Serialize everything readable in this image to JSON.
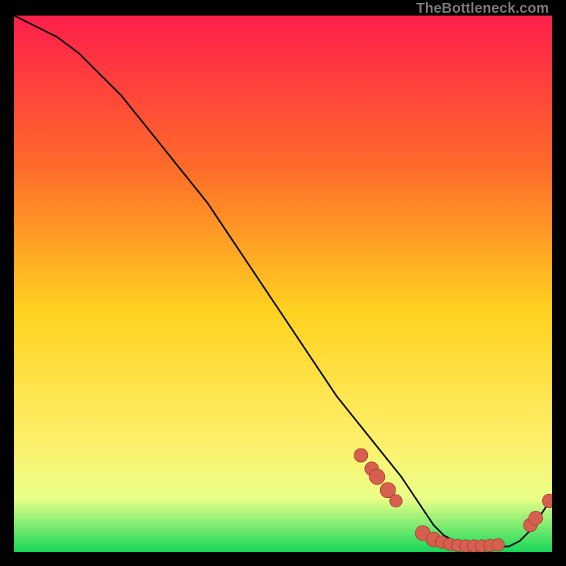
{
  "watermark": "TheBottleneck.com",
  "colors": {
    "gradient_top": "#ff1f4b",
    "gradient_mid_upper": "#ff6a2a",
    "gradient_mid": "#ffd21f",
    "gradient_mid_lower": "#ffee66",
    "gradient_lower": "#eaff88",
    "gradient_bottom": "#17d85a",
    "curve": "#111111",
    "marker_fill": "#d6604d",
    "marker_stroke": "#9c3a2e"
  },
  "chart_data": {
    "type": "line",
    "title": "",
    "xlabel": "",
    "ylabel": "",
    "xlim": [
      0,
      100
    ],
    "ylim": [
      0,
      100
    ],
    "grid": false,
    "legend": false,
    "series": [
      {
        "name": "bottleneck-curve",
        "x": [
          0,
          4,
          8,
          12,
          16,
          20,
          24,
          28,
          32,
          36,
          40,
          44,
          48,
          52,
          56,
          60,
          64,
          68,
          72,
          74,
          76,
          78,
          80,
          82,
          84,
          86,
          88,
          90,
          92,
          94,
          96,
          98,
          100
        ],
        "y": [
          100,
          98,
          96,
          93,
          89,
          85,
          80,
          75,
          70,
          65,
          59,
          53,
          47,
          41,
          35,
          29,
          24,
          19,
          14,
          11,
          8,
          5,
          3,
          2,
          1,
          1,
          1,
          1,
          1,
          2,
          4,
          7,
          10
        ]
      }
    ],
    "markers": [
      {
        "x": 64.5,
        "y": 18.0,
        "r": 1.6
      },
      {
        "x": 66.5,
        "y": 15.5,
        "r": 1.6
      },
      {
        "x": 67.5,
        "y": 14.0,
        "r": 1.9
      },
      {
        "x": 69.5,
        "y": 11.5,
        "r": 1.9
      },
      {
        "x": 71.0,
        "y": 9.5,
        "r": 1.4
      },
      {
        "x": 76.0,
        "y": 3.5,
        "r": 1.8
      },
      {
        "x": 78.0,
        "y": 2.3,
        "r": 1.8
      },
      {
        "x": 79.5,
        "y": 1.8,
        "r": 1.4
      },
      {
        "x": 81.0,
        "y": 1.4,
        "r": 1.4
      },
      {
        "x": 82.5,
        "y": 1.2,
        "r": 1.4
      },
      {
        "x": 84.0,
        "y": 1.1,
        "r": 1.4
      },
      {
        "x": 85.5,
        "y": 1.1,
        "r": 1.4
      },
      {
        "x": 87.0,
        "y": 1.1,
        "r": 1.4
      },
      {
        "x": 88.5,
        "y": 1.2,
        "r": 1.4
      },
      {
        "x": 90.0,
        "y": 1.3,
        "r": 1.4
      },
      {
        "x": 96.0,
        "y": 5.0,
        "r": 1.6
      },
      {
        "x": 97.0,
        "y": 6.3,
        "r": 1.6
      },
      {
        "x": 99.5,
        "y": 9.5,
        "r": 1.6
      }
    ]
  }
}
